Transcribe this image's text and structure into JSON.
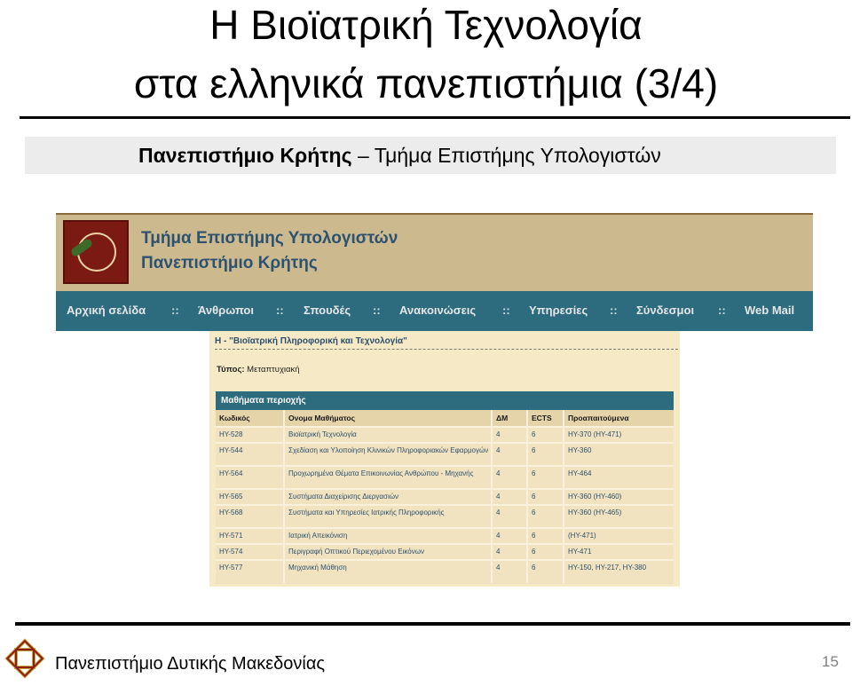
{
  "slide": {
    "title_line1": "Η Βιοϊατρική Τεχνολογία",
    "title_line2": "στα ελληνικά πανεπιστήμια (3/4)",
    "subtitle_bold": "Πανεπιστήμιο Κρήτης",
    "subtitle_rest": " – Τμήμα Επιστήμης Υπολογιστών",
    "footer": "Πανεπιστήμιο Δυτικής Μακεδονίας",
    "page_number": "15"
  },
  "screenshot": {
    "header": {
      "line1": "Τμήμα Επιστήμης Υπολογιστών",
      "line2": "Πανεπιστήμιο Κρήτης"
    },
    "nav": [
      "Αρχική σελίδα",
      "Άνθρωποι",
      "Σπουδές",
      "Ανακοινώσεις",
      "Υπηρεσίες",
      "Σύνδεσμοι",
      "Web Mail"
    ],
    "nav_sep": "::",
    "area_title": "H - \"Βιοϊατρική Πληροφορική και Τεχνολογία\"",
    "type_label": "Τύπος:",
    "type_value": " Μεταπτυχιακή",
    "table_title": "Μαθήματα περιοχής",
    "columns": [
      "Κωδικός",
      "Ονομα Μαθήματος",
      "ΔΜ",
      "ECTS",
      "Προαπαιτούμενα"
    ],
    "rows": [
      [
        "HY-528",
        "Βιοϊατρική Τεχνολογία",
        "4",
        "6",
        "HY-370 (HY-471)"
      ],
      [
        "HY-544",
        "Σχεδίαση και Υλοποίηση Κλινικών Πληροφοριακών Εφαρμογών",
        "4",
        "6",
        "HY-360"
      ],
      [
        "HY-564",
        "Προχωρημένα Θέματα Επικοινωνίας Ανθρώπου - Μηχανής",
        "4",
        "6",
        "HY-464"
      ],
      [
        "HY-565",
        "Συστήματα Διαχείρισης Διεργασιών",
        "4",
        "6",
        "HY-360 (HY-460)"
      ],
      [
        "HY-568",
        "Συστήματα και Υπηρεσίες Ιατρικής Πληροφορικής",
        "4",
        "6",
        "HY-360 (HY-465)"
      ],
      [
        "HY-571",
        "Ιατρική Απεικόνιση",
        "4",
        "6",
        "(HY-471)"
      ],
      [
        "HY-574",
        "Περιγραφή Οπτικού Περιεχομένου Εικόνων",
        "4",
        "6",
        "HY-471"
      ],
      [
        "HY-577",
        "Μηχανική Μάθηση",
        "4",
        "6",
        "HY-150, HY-217, HY-380"
      ]
    ]
  }
}
